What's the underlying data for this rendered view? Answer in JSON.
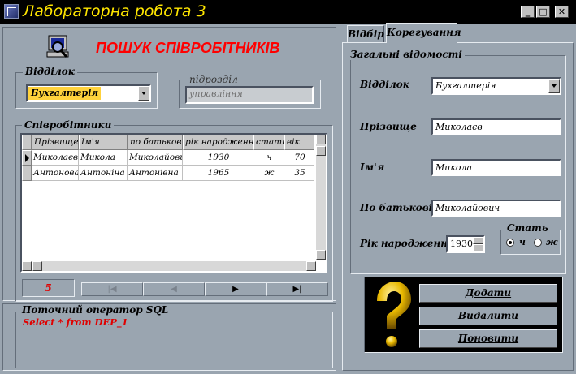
{
  "window": {
    "title": "Лабораторна робота 3",
    "minimize": "_",
    "maximize": "□",
    "close": "✕"
  },
  "left": {
    "heading": "ПОШУК СПІВРОБІТНИКІВ",
    "dept_group": {
      "caption": "Відділок",
      "value": "Бухгалтерія"
    },
    "sub_group": {
      "caption": "підрозділ",
      "value": "управління"
    },
    "employees_group": {
      "caption": "Співробітники"
    },
    "table": {
      "columns": [
        "Прізвище",
        "Ім'я",
        "по батькові",
        "рік народження",
        "стать",
        "вік"
      ],
      "rows": [
        [
          "Миколаєв",
          "Микола",
          "Миколайович",
          "1930",
          "ч",
          "70"
        ],
        [
          "Антонова",
          "Антоніна",
          "Антонівна",
          "1965",
          "ж",
          "35"
        ]
      ]
    },
    "record_count": "5",
    "nav": {
      "first": "|◀",
      "prior": "◀",
      "next": "▶",
      "last": "▶|"
    },
    "sql_group": {
      "caption": "Поточний оператор SQL",
      "text": "Select * from DEP_1"
    }
  },
  "right": {
    "tabs": [
      "Відбір",
      "Корегування"
    ],
    "group_caption": "Загальні відомості",
    "fields": {
      "dept_label": "Відділок",
      "dept_value": "Бухгалтерія",
      "surname_label": "Прізвище",
      "surname_value": "Миколаєв",
      "name_label": "Ім'я",
      "name_value": "Микола",
      "patronymic_label": "По батькові",
      "patronymic_value": "Миколайович",
      "year_label": "Рік народження",
      "year_value": "1930"
    },
    "gender": {
      "caption": "Стать",
      "male": "ч",
      "female": "ж",
      "selected": "ч"
    },
    "buttons": {
      "add": "Додати",
      "delete": "Видалити",
      "update": "Поновити"
    }
  },
  "colors": {
    "titlebar": "#000000",
    "title_text": "#ffe600",
    "background": "#9aa5b0",
    "heading": "#ff0000",
    "selected_field": "#ffd23c"
  }
}
